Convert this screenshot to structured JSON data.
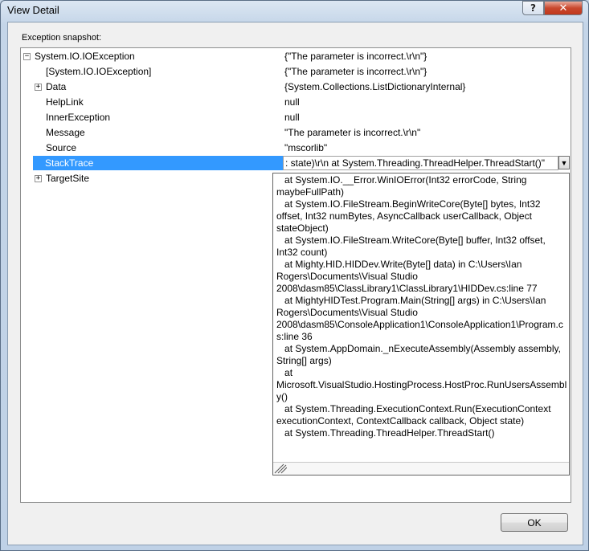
{
  "window": {
    "title": "View Detail",
    "help_glyph": "?",
    "close_glyph": "✕"
  },
  "snapshot_label": "Exception snapshot:",
  "rows": [
    {
      "name": "System.IO.IOException",
      "value": "{\"The parameter is incorrect.\\r\\n\"}",
      "expander": "−"
    },
    {
      "name": "[System.IO.IOException]",
      "value": "{\"The parameter is incorrect.\\r\\n\"}"
    },
    {
      "name": "Data",
      "value": "{System.Collections.ListDictionaryInternal}",
      "expander": "+"
    },
    {
      "name": "HelpLink",
      "value": "null"
    },
    {
      "name": "InnerException",
      "value": "null"
    },
    {
      "name": "Message",
      "value": "\"The parameter is incorrect.\\r\\n\""
    },
    {
      "name": "Source",
      "value": "\"mscorlib\""
    },
    {
      "name": "StackTrace",
      "value": ": state)\\r\\n   at System.Threading.ThreadHelper.ThreadStart()\"",
      "dropdown_glyph": "▼"
    },
    {
      "name": "TargetSite",
      "value": "",
      "expander": "+"
    }
  ],
  "stack_trace_popup": "   at System.IO.__Error.WinIOError(Int32 errorCode, String maybeFullPath)\n   at System.IO.FileStream.BeginWriteCore(Byte[] bytes, Int32 offset, Int32 numBytes, AsyncCallback userCallback, Object stateObject)\n   at System.IO.FileStream.WriteCore(Byte[] buffer, Int32 offset, Int32 count)\n   at Mighty.HID.HIDDev.Write(Byte[] data) in C:\\Users\\Ian Rogers\\Documents\\Visual Studio 2008\\dasm85\\ClassLibrary1\\ClassLibrary1\\HIDDev.cs:line 77\n   at MightyHIDTest.Program.Main(String[] args) in C:\\Users\\Ian Rogers\\Documents\\Visual Studio 2008\\dasm85\\ConsoleApplication1\\ConsoleApplication1\\Program.cs:line 36\n   at System.AppDomain._nExecuteAssembly(Assembly assembly, String[] args)\n   at Microsoft.VisualStudio.HostingProcess.HostProc.RunUsersAssembly()\n   at System.Threading.ExecutionContext.Run(ExecutionContext executionContext, ContextCallback callback, Object state)\n   at System.Threading.ThreadHelper.ThreadStart()",
  "ok_label": "OK",
  "colors": {
    "selection": "#3399ff",
    "close_button": "#c9482e",
    "window_frame": "#c4d5e8"
  }
}
